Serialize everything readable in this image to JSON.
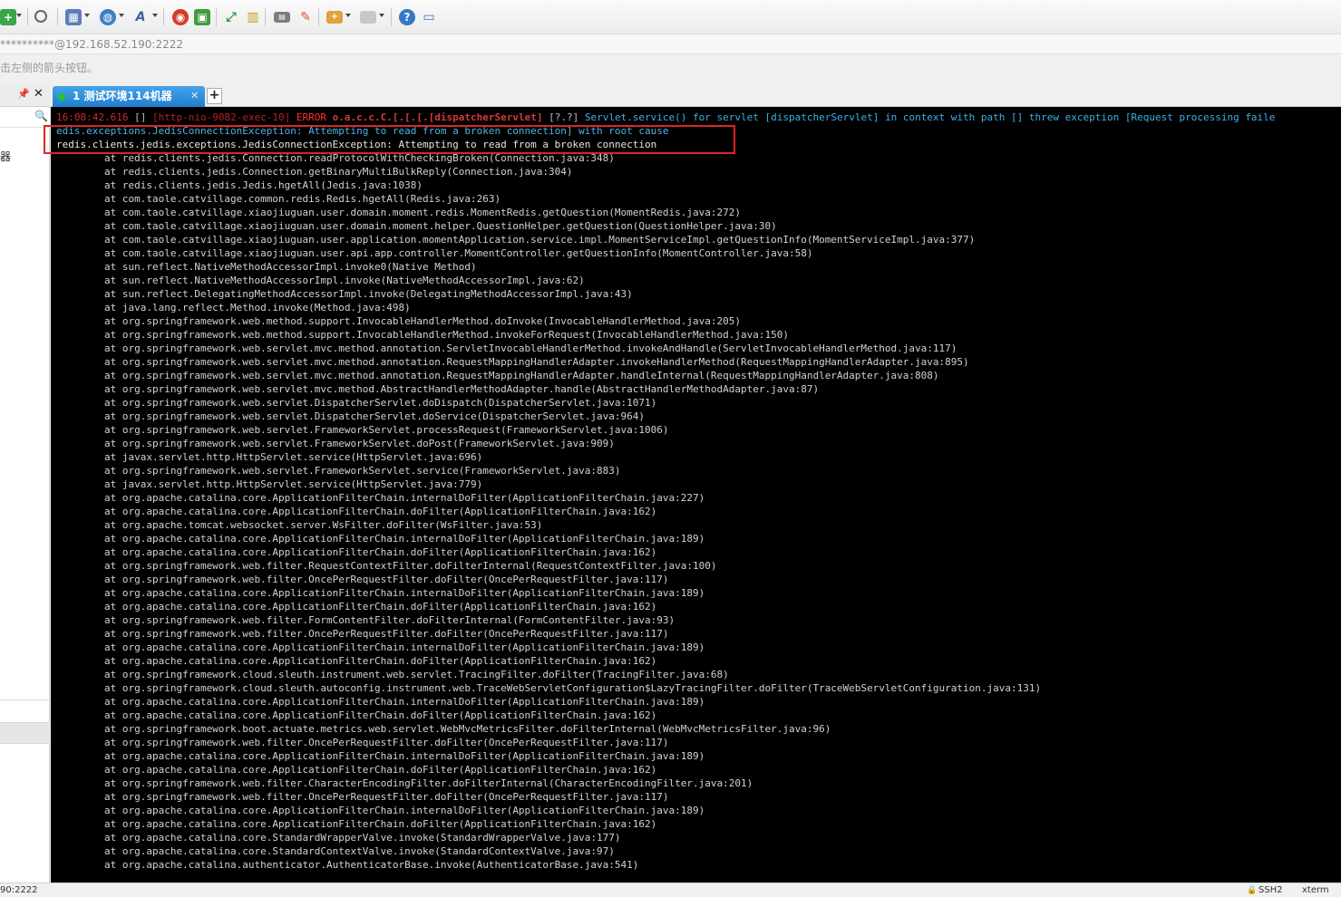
{
  "address": {
    "value": "**********@192.168.52.190:2222"
  },
  "hint": {
    "text": "击左侧的箭头按钮。"
  },
  "left_panel": {
    "pin_glyph": "📌",
    "close_glyph": "✕",
    "search_glyph": "🔍",
    "tree_item_label": "器"
  },
  "tabs": [
    {
      "label": "1 测试环境114机器",
      "close_glyph": "✕",
      "status_color": "#23c82e",
      "active": true
    }
  ],
  "tab_add_glyph": "+",
  "terminal": {
    "first_line": {
      "time": "16:08:42.616",
      "bracket": " [] ",
      "thread": "[http-nio-9082-exec-10]",
      "level": " ERROR ",
      "logger": "o.a.c.c.C.[.[.[.[dispatcherServlet]",
      "code": " [?.?] ",
      "message": "Servlet.service() for servlet [dispatcherServlet] in context with path [] threw exception [Request processing faile"
    },
    "cause_line": "edis.exceptions.JedisConnectionException: Attempting to read from a broken connection] with root cause",
    "exception_line": "redis.clients.jedis.exceptions.JedisConnectionException: Attempting to read from a broken connection",
    "stack": [
      "        at redis.clients.jedis.Connection.readProtocolWithCheckingBroken(Connection.java:348)",
      "        at redis.clients.jedis.Connection.getBinaryMultiBulkReply(Connection.java:304)",
      "        at redis.clients.jedis.Jedis.hgetAll(Jedis.java:1038)",
      "        at com.taole.catvillage.common.redis.Redis.hgetAll(Redis.java:263)",
      "        at com.taole.catvillage.xiaojiuguan.user.domain.moment.redis.MomentRedis.getQuestion(MomentRedis.java:272)",
      "        at com.taole.catvillage.xiaojiuguan.user.domain.moment.helper.QuestionHelper.getQuestion(QuestionHelper.java:30)",
      "        at com.taole.catvillage.xiaojiuguan.user.application.momentApplication.service.impl.MomentServiceImpl.getQuestionInfo(MomentServiceImpl.java:377)",
      "        at com.taole.catvillage.xiaojiuguan.user.api.app.controller.MomentController.getQuestionInfo(MomentController.java:58)",
      "        at sun.reflect.NativeMethodAccessorImpl.invoke0(Native Method)",
      "        at sun.reflect.NativeMethodAccessorImpl.invoke(NativeMethodAccessorImpl.java:62)",
      "        at sun.reflect.DelegatingMethodAccessorImpl.invoke(DelegatingMethodAccessorImpl.java:43)",
      "        at java.lang.reflect.Method.invoke(Method.java:498)",
      "        at org.springframework.web.method.support.InvocableHandlerMethod.doInvoke(InvocableHandlerMethod.java:205)",
      "        at org.springframework.web.method.support.InvocableHandlerMethod.invokeForRequest(InvocableHandlerMethod.java:150)",
      "        at org.springframework.web.servlet.mvc.method.annotation.ServletInvocableHandlerMethod.invokeAndHandle(ServletInvocableHandlerMethod.java:117)",
      "        at org.springframework.web.servlet.mvc.method.annotation.RequestMappingHandlerAdapter.invokeHandlerMethod(RequestMappingHandlerAdapter.java:895)",
      "        at org.springframework.web.servlet.mvc.method.annotation.RequestMappingHandlerAdapter.handleInternal(RequestMappingHandlerAdapter.java:808)",
      "        at org.springframework.web.servlet.mvc.method.AbstractHandlerMethodAdapter.handle(AbstractHandlerMethodAdapter.java:87)",
      "        at org.springframework.web.servlet.DispatcherServlet.doDispatch(DispatcherServlet.java:1071)",
      "        at org.springframework.web.servlet.DispatcherServlet.doService(DispatcherServlet.java:964)",
      "        at org.springframework.web.servlet.FrameworkServlet.processRequest(FrameworkServlet.java:1006)",
      "        at org.springframework.web.servlet.FrameworkServlet.doPost(FrameworkServlet.java:909)",
      "        at javax.servlet.http.HttpServlet.service(HttpServlet.java:696)",
      "        at org.springframework.web.servlet.FrameworkServlet.service(FrameworkServlet.java:883)",
      "        at javax.servlet.http.HttpServlet.service(HttpServlet.java:779)",
      "        at org.apache.catalina.core.ApplicationFilterChain.internalDoFilter(ApplicationFilterChain.java:227)",
      "        at org.apache.catalina.core.ApplicationFilterChain.doFilter(ApplicationFilterChain.java:162)",
      "        at org.apache.tomcat.websocket.server.WsFilter.doFilter(WsFilter.java:53)",
      "        at org.apache.catalina.core.ApplicationFilterChain.internalDoFilter(ApplicationFilterChain.java:189)",
      "        at org.apache.catalina.core.ApplicationFilterChain.doFilter(ApplicationFilterChain.java:162)",
      "        at org.springframework.web.filter.RequestContextFilter.doFilterInternal(RequestContextFilter.java:100)",
      "        at org.springframework.web.filter.OncePerRequestFilter.doFilter(OncePerRequestFilter.java:117)",
      "        at org.apache.catalina.core.ApplicationFilterChain.internalDoFilter(ApplicationFilterChain.java:189)",
      "        at org.apache.catalina.core.ApplicationFilterChain.doFilter(ApplicationFilterChain.java:162)",
      "        at org.springframework.web.filter.FormContentFilter.doFilterInternal(FormContentFilter.java:93)",
      "        at org.springframework.web.filter.OncePerRequestFilter.doFilter(OncePerRequestFilter.java:117)",
      "        at org.apache.catalina.core.ApplicationFilterChain.internalDoFilter(ApplicationFilterChain.java:189)",
      "        at org.apache.catalina.core.ApplicationFilterChain.doFilter(ApplicationFilterChain.java:162)",
      "        at org.springframework.cloud.sleuth.instrument.web.servlet.TracingFilter.doFilter(TracingFilter.java:68)",
      "        at org.springframework.cloud.sleuth.autoconfig.instrument.web.TraceWebServletConfiguration$LazyTracingFilter.doFilter(TraceWebServletConfiguration.java:131)",
      "        at org.apache.catalina.core.ApplicationFilterChain.internalDoFilter(ApplicationFilterChain.java:189)",
      "        at org.apache.catalina.core.ApplicationFilterChain.doFilter(ApplicationFilterChain.java:162)",
      "        at org.springframework.boot.actuate.metrics.web.servlet.WebMvcMetricsFilter.doFilterInternal(WebMvcMetricsFilter.java:96)",
      "        at org.springframework.web.filter.OncePerRequestFilter.doFilter(OncePerRequestFilter.java:117)",
      "        at org.apache.catalina.core.ApplicationFilterChain.internalDoFilter(ApplicationFilterChain.java:189)",
      "        at org.apache.catalina.core.ApplicationFilterChain.doFilter(ApplicationFilterChain.java:162)",
      "        at org.springframework.web.filter.CharacterEncodingFilter.doFilterInternal(CharacterEncodingFilter.java:201)",
      "        at org.springframework.web.filter.OncePerRequestFilter.doFilter(OncePerRequestFilter.java:117)",
      "        at org.apache.catalina.core.ApplicationFilterChain.internalDoFilter(ApplicationFilterChain.java:189)",
      "        at org.apache.catalina.core.ApplicationFilterChain.doFilter(ApplicationFilterChain.java:162)",
      "        at org.apache.catalina.core.StandardWrapperValve.invoke(StandardWrapperValve.java:177)",
      "        at org.apache.catalina.core.StandardContextValve.invoke(StandardContextValve.java:97)",
      "        at org.apache.catalina.authenticator.AuthenticatorBase.invoke(AuthenticatorBase.java:541)"
    ]
  },
  "status": {
    "left": "90:2222",
    "lock_glyph": "🔒",
    "protocol": "SSH2",
    "terminal_type": "xterm"
  },
  "colors": {
    "terminal_bg": "#000000",
    "tab_active": "#1f7fd1",
    "error_red": "#ff2f2f",
    "highlight_box": "#e02424",
    "cyan_text": "#4ab4e6"
  },
  "icons": [
    "new-session-icon",
    "search-icon",
    "layout-icon",
    "globe-icon",
    "font-icon",
    "xshell-icon",
    "xftp-icon",
    "fullscreen-icon",
    "lock-icon",
    "keyboard-icon",
    "highlighter-icon",
    "add-folder-icon",
    "window-icon",
    "help-icon",
    "chat-icon"
  ]
}
